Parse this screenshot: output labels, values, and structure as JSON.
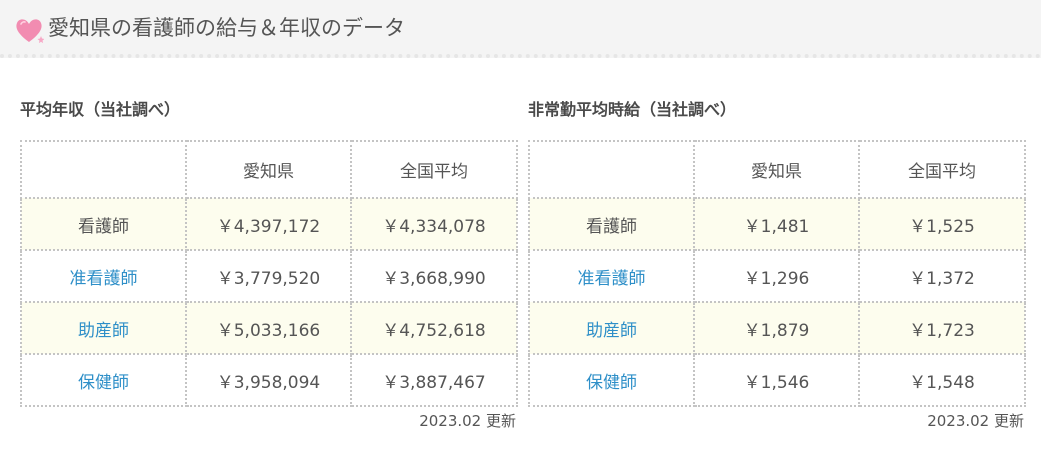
{
  "header": {
    "title": "愛知県の看護師の給与＆年収のデータ",
    "icon": "heart-icon",
    "icon_color": "#f28cb1"
  },
  "colors": {
    "link": "#2e8fc8",
    "highlight_row": "#fdfdee",
    "header_bg": "#f4f4f4"
  },
  "tables": [
    {
      "title": "平均年収（当社調べ）",
      "columns": [
        "",
        "愛知県",
        "全国平均"
      ],
      "rows": [
        {
          "label": "看護師",
          "aichi": "￥4,397,172",
          "national": "￥4,334,078"
        },
        {
          "label": "准看護師",
          "aichi": "￥3,779,520",
          "national": "￥3,668,990"
        },
        {
          "label": "助産師",
          "aichi": "￥5,033,166",
          "national": "￥4,752,618"
        },
        {
          "label": "保健師",
          "aichi": "￥3,958,094",
          "national": "￥3,887,467"
        }
      ],
      "updated": "2023.02 更新"
    },
    {
      "title": "非常勤平均時給（当社調べ）",
      "columns": [
        "",
        "愛知県",
        "全国平均"
      ],
      "rows": [
        {
          "label": "看護師",
          "aichi": "￥1,481",
          "national": "￥1,525"
        },
        {
          "label": "准看護師",
          "aichi": "￥1,296",
          "national": "￥1,372"
        },
        {
          "label": "助産師",
          "aichi": "￥1,879",
          "national": "￥1,723"
        },
        {
          "label": "保健師",
          "aichi": "￥1,546",
          "national": "￥1,548"
        }
      ],
      "updated": "2023.02 更新"
    }
  ]
}
